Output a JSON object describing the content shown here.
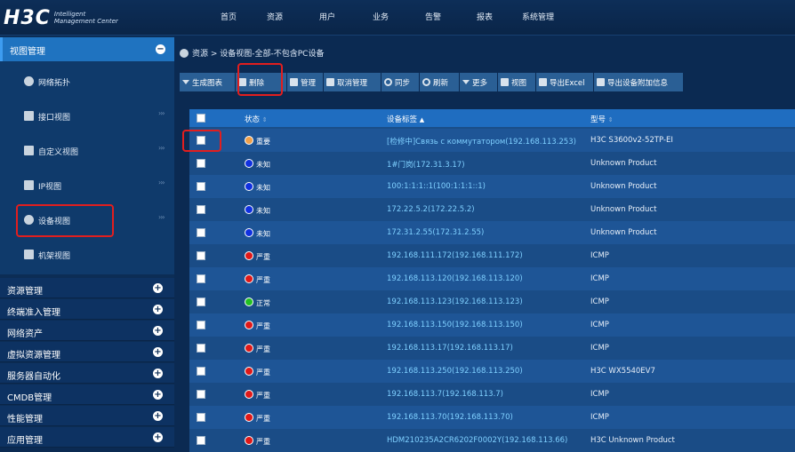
{
  "topbar": {
    "logo_main": "H3C",
    "logo_sub1": "Intelligent",
    "logo_sub2": "Management Center",
    "nav": [
      "首页",
      "资源",
      "用户",
      "业务",
      "告警",
      "报表",
      "系统管理"
    ]
  },
  "sidebar": {
    "header": "视图管理",
    "header_toggle": "−",
    "subitems": [
      {
        "label": "网络拓扑",
        "icon": "network-topology-icon",
        "chevron": ""
      },
      {
        "label": "接口视图",
        "icon": "interface-view-icon",
        "chevron": "›››"
      },
      {
        "label": "自定义视图",
        "icon": "custom-view-icon",
        "chevron": "›››"
      },
      {
        "label": "IP视图",
        "icon": "ip-view-icon",
        "chevron": "›››"
      },
      {
        "label": "设备视图",
        "icon": "device-view-icon",
        "chevron": "›››"
      },
      {
        "label": "机架视图",
        "icon": "rack-view-icon",
        "chevron": ""
      }
    ],
    "categories": [
      "资源管理",
      "终端准入管理",
      "网络资产",
      "虚拟资源管理",
      "服务器自动化",
      "CMDB管理",
      "性能管理",
      "应用管理"
    ],
    "plus": "+"
  },
  "breadcrumb": {
    "text": "资源 > 设备视图-全部-不包含PC设备"
  },
  "toolbar": [
    {
      "label": "生成图表",
      "icon": "dropdown-arrow-icon"
    },
    {
      "label": "删除",
      "icon": "trash-icon"
    },
    {
      "label": "管理",
      "icon": "manage-icon"
    },
    {
      "label": "取消管理",
      "icon": "unmanage-icon"
    },
    {
      "label": "同步",
      "icon": "sync-icon"
    },
    {
      "label": "刷新",
      "icon": "refresh-icon"
    },
    {
      "label": "更多",
      "icon": "dropdown-arrow-icon"
    },
    {
      "label": "视图",
      "icon": "view-icon"
    },
    {
      "label": "导出Excel",
      "icon": "export-excel-icon"
    },
    {
      "label": "导出设备附加信息",
      "icon": "export-info-icon"
    }
  ],
  "table": {
    "headers": {
      "status": "状态",
      "label": "设备标签",
      "model": "型号"
    },
    "sort_neutral": "⇕",
    "sort_up": "▲",
    "rows": [
      {
        "status": "重要",
        "color": "#f0a04a",
        "label": "[检修中]Связь с коммутатором(192.168.113.253)",
        "model": "H3C S3600v2-52TP-EI"
      },
      {
        "status": "未知",
        "color": "#1030e0",
        "label": "1#门岗(172.31.3.17)",
        "model": "Unknown Product"
      },
      {
        "status": "未知",
        "color": "#1030e0",
        "label": "100:1:1:1::1(100:1:1:1::1)",
        "model": "Unknown Product"
      },
      {
        "status": "未知",
        "color": "#1030e0",
        "label": "172.22.5.2(172.22.5.2)",
        "model": "Unknown Product"
      },
      {
        "status": "未知",
        "color": "#1030e0",
        "label": "172.31.2.55(172.31.2.55)",
        "model": "Unknown Product"
      },
      {
        "status": "严重",
        "color": "#e01818",
        "label": "192.168.111.172(192.168.111.172)",
        "model": "ICMP"
      },
      {
        "status": "严重",
        "color": "#e01818",
        "label": "192.168.113.120(192.168.113.120)",
        "model": "ICMP"
      },
      {
        "status": "正常",
        "color": "#22c022",
        "label": "192.168.113.123(192.168.113.123)",
        "model": "ICMP"
      },
      {
        "status": "严重",
        "color": "#e01818",
        "label": "192.168.113.150(192.168.113.150)",
        "model": "ICMP"
      },
      {
        "status": "严重",
        "color": "#e01818",
        "label": "192.168.113.17(192.168.113.17)",
        "model": "ICMP"
      },
      {
        "status": "严重",
        "color": "#e01818",
        "label": "192.168.113.250(192.168.113.250)",
        "model": "H3C WX5540EV7"
      },
      {
        "status": "严重",
        "color": "#e01818",
        "label": "192.168.113.7(192.168.113.7)",
        "model": "ICMP"
      },
      {
        "status": "严重",
        "color": "#e01818",
        "label": "192.168.113.70(192.168.113.70)",
        "model": "ICMP"
      },
      {
        "status": "严重",
        "color": "#e01818",
        "label": "HDM210235A2CR6202F0002Y(192.168.113.66)",
        "model": "H3C Unknown Product"
      }
    ]
  }
}
